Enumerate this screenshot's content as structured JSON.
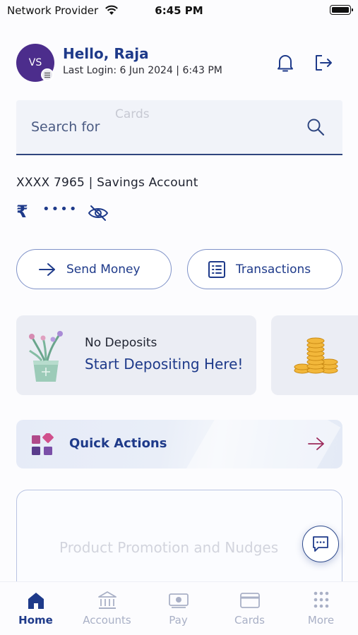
{
  "status_bar": {
    "carrier": "Network Provider",
    "time": "6:45 PM"
  },
  "header": {
    "avatar_initials": "VS",
    "greeting": "Hello, Raja",
    "last_login": "Last Login: 6 Jun 2024 | 6:43 PM"
  },
  "search": {
    "label": "Search for",
    "hint": "Cards"
  },
  "account": {
    "summary": "XXXX 7965 | Savings Account",
    "currency_symbol": "₹",
    "masked_balance": "••••"
  },
  "actions": {
    "send_money": "Send Money",
    "transactions": "Transactions"
  },
  "deposits": {
    "title": "No Deposits",
    "cta": "Start Depositing Here!"
  },
  "quick_actions": {
    "label": "Quick Actions"
  },
  "promo": {
    "text": "Product Promotion and Nudges"
  },
  "tabs": [
    {
      "label": "Home",
      "icon": "home-icon",
      "active": true
    },
    {
      "label": "Accounts",
      "icon": "bank-icon",
      "active": false
    },
    {
      "label": "Pay",
      "icon": "cash-icon",
      "active": false
    },
    {
      "label": "Cards",
      "icon": "card-icon",
      "active": false
    },
    {
      "label": "More",
      "icon": "grid-dots-icon",
      "active": false
    }
  ],
  "colors": {
    "primary": "#1e3a8a",
    "avatar": "#4c2d8c",
    "inactive": "#a9b0c6",
    "accent_arrow": "#9c2a5b"
  }
}
